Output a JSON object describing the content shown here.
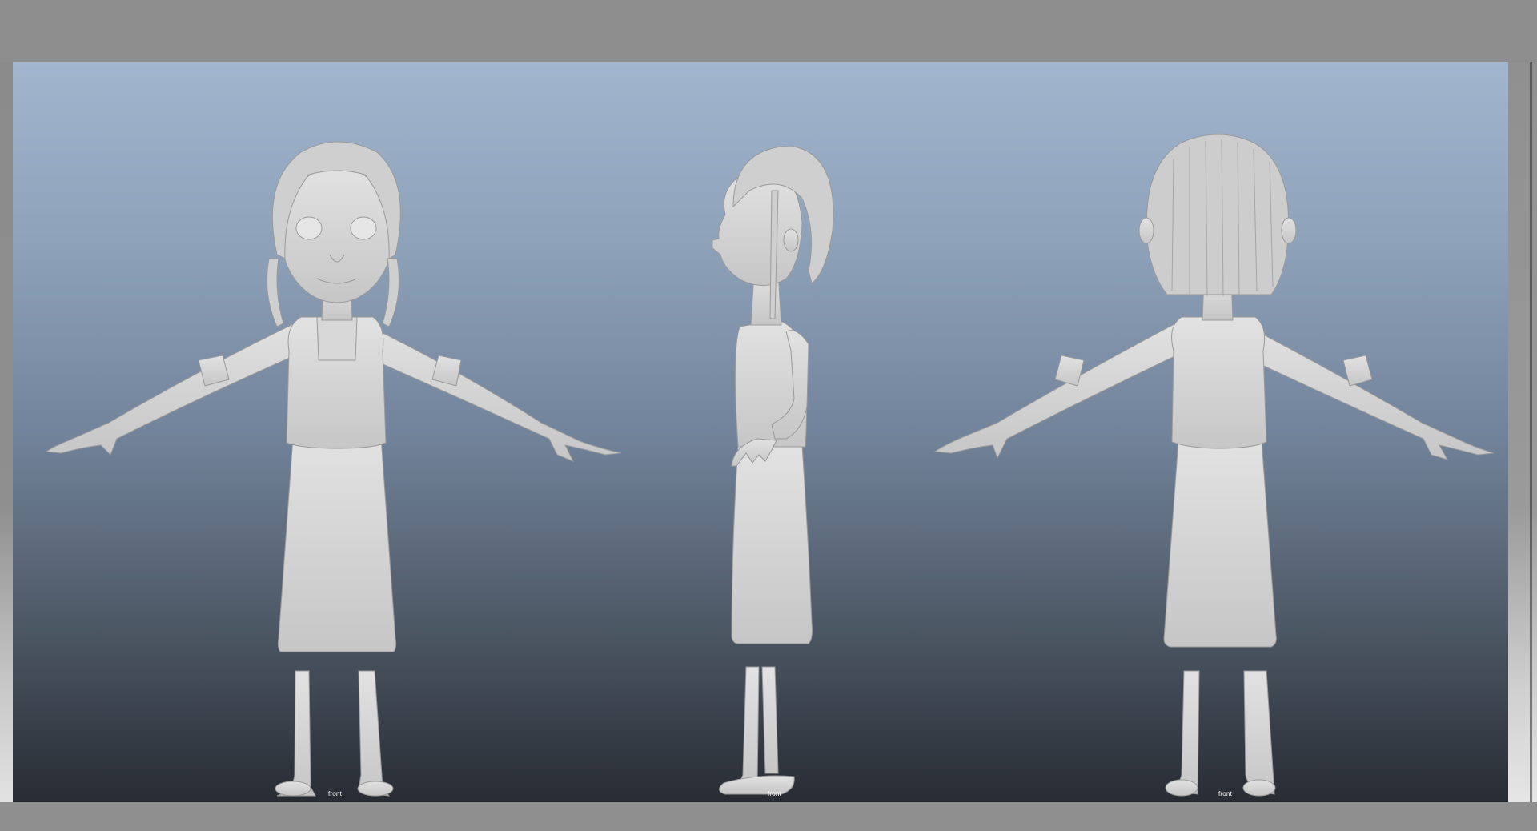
{
  "viewport": {
    "background_top": "#a1b6ce",
    "background_bottom": "#282c33",
    "model_color": "#d4d4d4"
  },
  "views": [
    {
      "id": "front",
      "camera_label": "front"
    },
    {
      "id": "side",
      "camera_label": "front"
    },
    {
      "id": "back",
      "camera_label": "front"
    }
  ]
}
